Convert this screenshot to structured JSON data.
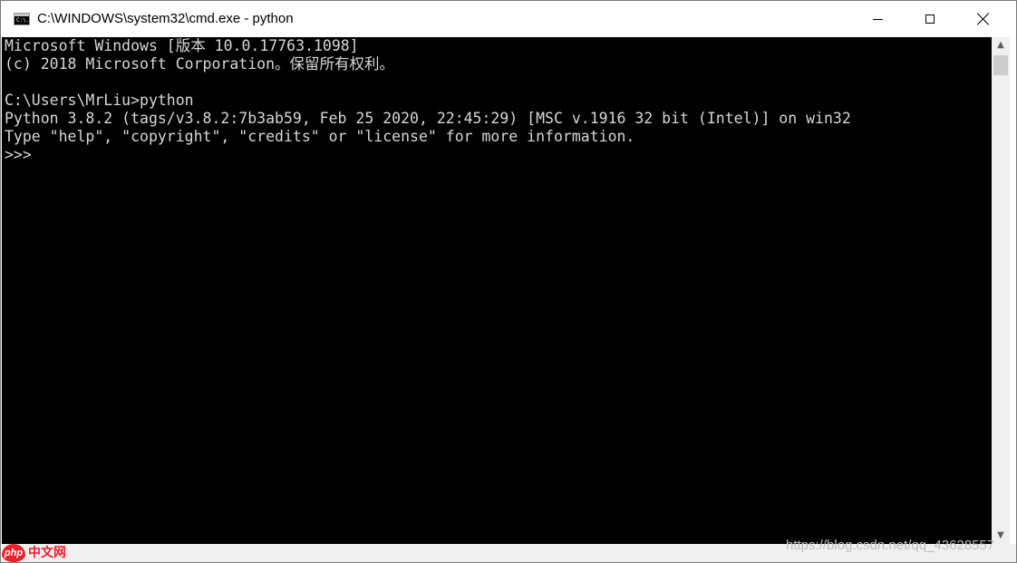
{
  "window": {
    "title": "C:\\WINDOWS\\system32\\cmd.exe - python",
    "icon_name": "cmd-icon",
    "icon_text": "C:\\."
  },
  "console": {
    "background": "#000000",
    "foreground": "#d7d7d7",
    "lines": [
      "Microsoft Windows [版本 10.0.17763.1098]",
      "(c) 2018 Microsoft Corporation。保留所有权利。",
      "",
      "C:\\Users\\MrLiu>python",
      "Python 3.8.2 (tags/v3.8.2:7b3ab59, Feb 25 2020, 22:45:29) [MSC v.1916 32 bit (Intel)] on win32",
      "Type \"help\", \"copyright\", \"credits\" or \"license\" for more information.",
      ">>>"
    ]
  },
  "scrollbar": {
    "up_arrow": "▲",
    "down_arrow": "▼"
  },
  "watermark": {
    "text": "https://blog.csdn.net/qq_43628557"
  },
  "logo": {
    "badge": "php",
    "text": "中文网",
    "color": "#e8222a"
  }
}
